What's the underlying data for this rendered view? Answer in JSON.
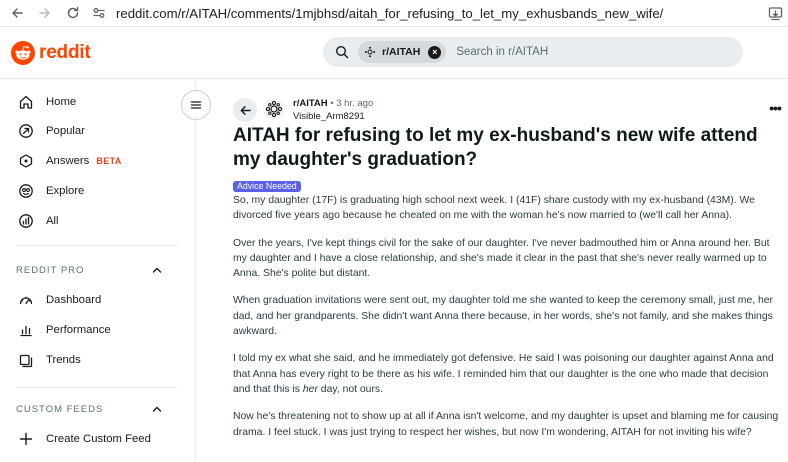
{
  "browser": {
    "url": "reddit.com/r/AITAH/comments/1mjbhsd/aitah_for_refusing_to_let_my_exhusbands_new_wife/"
  },
  "header": {
    "logo_text": "reddit",
    "search": {
      "chip_label": "r/AITAH",
      "placeholder": "Search in r/AITAH"
    }
  },
  "sidebar": {
    "nav": [
      {
        "label": "Home",
        "icon": "home-icon"
      },
      {
        "label": "Popular",
        "icon": "popular-icon"
      },
      {
        "label": "Answers",
        "badge": "BETA",
        "icon": "answers-icon"
      },
      {
        "label": "Explore",
        "icon": "explore-icon"
      },
      {
        "label": "All",
        "icon": "all-icon"
      }
    ],
    "reddit_pro": {
      "title": "REDDIT PRO",
      "items": [
        {
          "label": "Dashboard",
          "icon": "dashboard-icon"
        },
        {
          "label": "Performance",
          "icon": "performance-icon"
        },
        {
          "label": "Trends",
          "icon": "trends-icon"
        }
      ]
    },
    "custom_feeds": {
      "title": "CUSTOM FEEDS",
      "items": [
        {
          "label": "Create Custom Feed",
          "icon": "plus-icon"
        }
      ]
    }
  },
  "post": {
    "subreddit": "r/AITAH",
    "time": "• 3 hr. ago",
    "author": "Visible_Arm8291",
    "title": "AITAH for refusing to let my ex-husband's new wife attend my daughter's graduation?",
    "flair": "Advice Needed",
    "paragraphs": [
      "So, my daughter (17F) is graduating high school next week. I (41F) share custody with my ex-husband (43M). We divorced five years ago because he cheated on me with the woman he's now married to (we'll call her Anna).",
      "Over the years, I've kept things civil for the sake of our daughter. I've never badmouthed him or Anna around her. But my daughter and I have a close relationship, and she's made it clear in the past that she's never really warmed up to Anna. She's polite but distant.",
      "When graduation invitations were sent out, my daughter told me she wanted to keep the ceremony small, just me, her dad, and her grandparents. She didn't want Anna there because, in her words, she's not family, and she makes things awkward.",
      {
        "before": "I told my ex what she said, and he immediately got defensive. He said I was poisoning our daughter against Anna and that Anna has every right to be there as his wife. I reminded him that our daughter is the one who made that decision and that this is ",
        "emphasis": "her",
        "after": " day, not ours."
      },
      "Now he's threatening not to show up at all if Anna isn't welcome, and my daughter is upset and blaming me for causing drama. I feel stuck. I was just trying to respect her wishes, but now I'm wondering, AITAH for not inviting his wife?"
    ]
  }
}
